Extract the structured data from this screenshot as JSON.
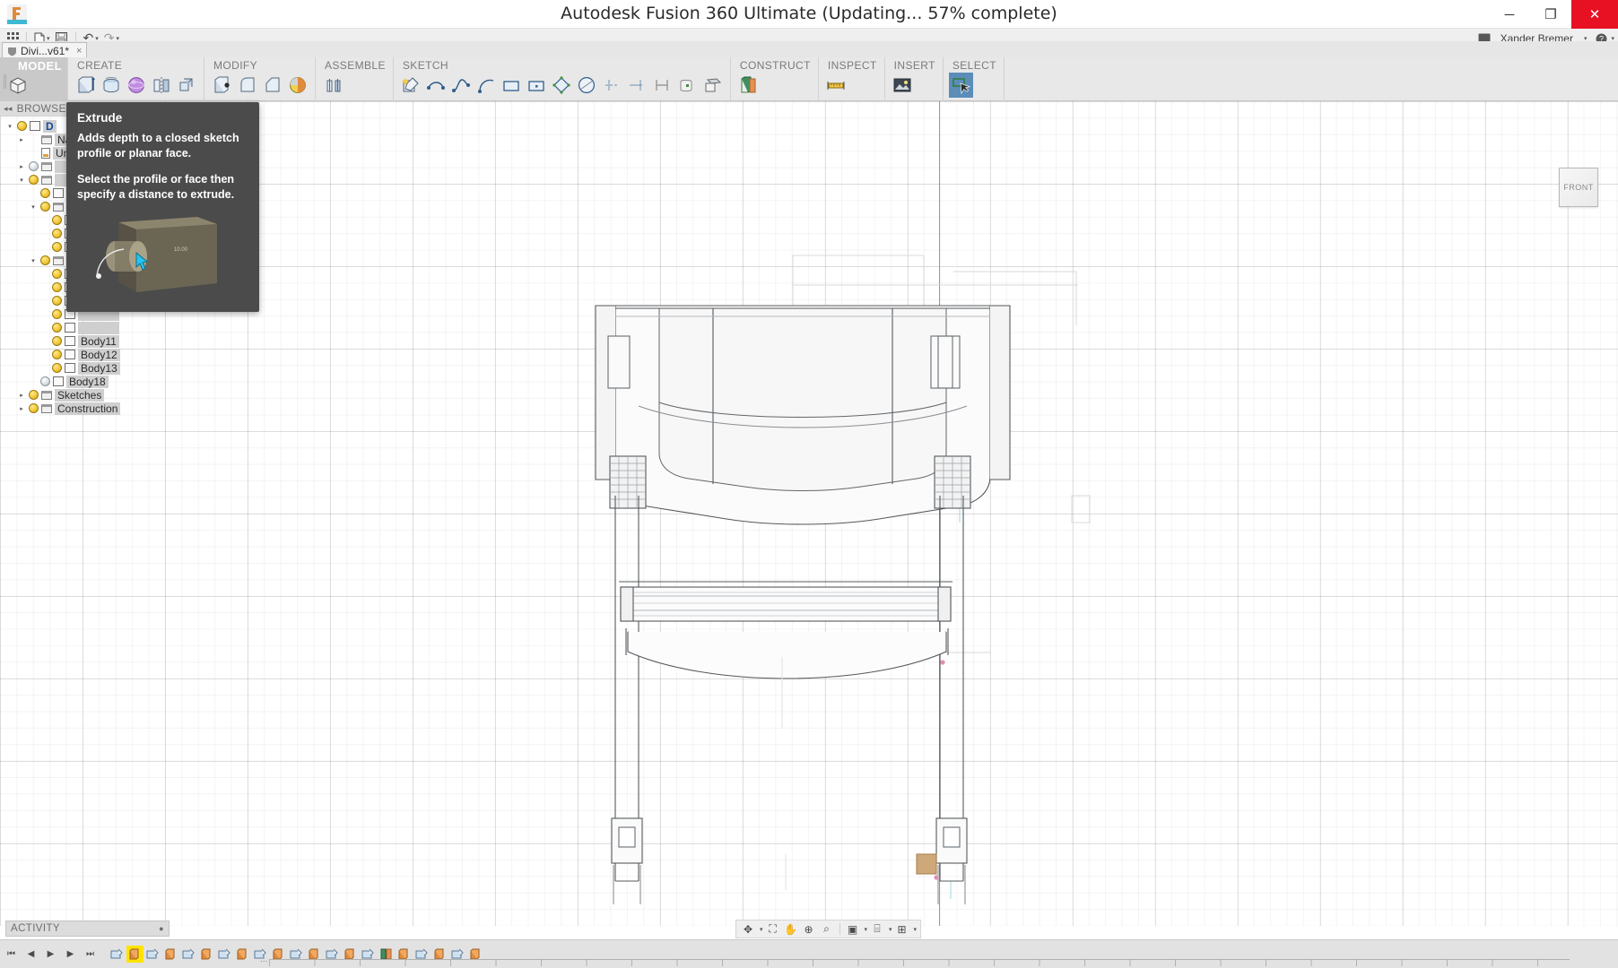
{
  "window": {
    "title": "Autodesk Fusion 360 Ultimate  (Updating... 57% complete)",
    "minimize_label": "─",
    "restore_label": "❐",
    "close_label": "✕",
    "app_icon": "fusion-360-logo"
  },
  "quick_access": {
    "grid_label": "▒",
    "new_label": "⬜",
    "save_label": "💾",
    "undo_label": "↶",
    "redo_label": "↷",
    "caret": "▾",
    "jobs_icon": "job-status-icon",
    "user_name": "Xander Bremer",
    "help_label": "?"
  },
  "document_tab": {
    "label": "Divi...v61*",
    "close_label": "×",
    "icon": "document-shield-icon"
  },
  "ribbon": {
    "groups": [
      {
        "name": "MODEL",
        "label": "MODEL",
        "is_workspace": true,
        "items": [
          {
            "name": "model-workspace-icon",
            "glyph": "box"
          }
        ]
      },
      {
        "name": "CREATE",
        "label": "CREATE",
        "items": [
          {
            "name": "extrude-icon",
            "glyph": "extrude"
          },
          {
            "name": "revolve-icon",
            "glyph": "revolve"
          },
          {
            "name": "sweep-icon",
            "glyph": "sphere"
          },
          {
            "name": "mirror-icon",
            "glyph": "mirror"
          },
          {
            "name": "pattern-icon",
            "glyph": "pattern"
          }
        ]
      },
      {
        "name": "MODIFY",
        "label": "MODIFY",
        "items": [
          {
            "name": "press-pull-icon",
            "glyph": "presspull"
          },
          {
            "name": "fillet-icon",
            "glyph": "fillet"
          },
          {
            "name": "chamfer-icon",
            "glyph": "chamfer"
          },
          {
            "name": "appearance-icon",
            "glyph": "appearance"
          }
        ]
      },
      {
        "name": "ASSEMBLE",
        "label": "ASSEMBLE",
        "items": [
          {
            "name": "joint-icon",
            "glyph": "joint"
          }
        ]
      },
      {
        "name": "SKETCH",
        "label": "SKETCH",
        "items": [
          {
            "name": "create-sketch-icon",
            "glyph": "newsketch"
          },
          {
            "name": "line-icon",
            "glyph": "spline"
          },
          {
            "name": "spline-icon",
            "glyph": "spline2"
          },
          {
            "name": "arc-icon",
            "glyph": "arc"
          },
          {
            "name": "rectangle-icon",
            "glyph": "rect"
          },
          {
            "name": "center-rectangle-icon",
            "glyph": "rectc"
          },
          {
            "name": "polygon-icon",
            "glyph": "diamond"
          },
          {
            "name": "ellipse-icon",
            "glyph": "ellipse"
          },
          {
            "name": "sketch-dimension-icon",
            "glyph": "dim1"
          },
          {
            "name": "trim-icon",
            "glyph": "dim2"
          },
          {
            "name": "offset-icon",
            "glyph": "offset"
          },
          {
            "name": "project-icon",
            "glyph": "project"
          },
          {
            "name": "stop-sketch-icon",
            "glyph": "stopsketch"
          }
        ]
      },
      {
        "name": "CONSTRUCT",
        "label": "CONSTRUCT",
        "items": [
          {
            "name": "construct-plane-icon",
            "glyph": "plane"
          }
        ]
      },
      {
        "name": "INSPECT",
        "label": "INSPECT",
        "items": [
          {
            "name": "measure-icon",
            "glyph": "ruler"
          }
        ]
      },
      {
        "name": "INSERT",
        "label": "INSERT",
        "items": [
          {
            "name": "insert-mcmaster-icon",
            "glyph": "image"
          }
        ]
      },
      {
        "name": "SELECT",
        "label": "SELECT",
        "items": [
          {
            "name": "select-icon",
            "glyph": "select",
            "selected": true
          }
        ]
      }
    ]
  },
  "browser": {
    "header": "BROWSER",
    "collapse_icon": "◂◂",
    "tree": [
      {
        "label": "D",
        "indent": 0,
        "arrow": "open",
        "bulb": "on",
        "icon": "body",
        "root": true
      },
      {
        "label": "Na",
        "indent": 1,
        "arrow": "closed",
        "bulb": "none",
        "icon": "folder"
      },
      {
        "label": "Un",
        "indent": 1,
        "arrow": "none",
        "bulb": "none",
        "icon": "doc"
      },
      {
        "label": "",
        "indent": 1,
        "arrow": "closed",
        "bulb": "off",
        "icon": "folder"
      },
      {
        "label": "",
        "indent": 1,
        "arrow": "open",
        "bulb": "on",
        "icon": "folder"
      },
      {
        "label": "",
        "indent": 2,
        "arrow": "none",
        "bulb": "on",
        "icon": "body"
      },
      {
        "label": "",
        "indent": 2,
        "arrow": "open",
        "bulb": "on",
        "icon": "folder"
      },
      {
        "label": "",
        "indent": 3,
        "arrow": "none",
        "bulb": "on",
        "icon": "body"
      },
      {
        "label": "",
        "indent": 3,
        "arrow": "none",
        "bulb": "on",
        "icon": "body"
      },
      {
        "label": "",
        "indent": 3,
        "arrow": "none",
        "bulb": "on",
        "icon": "body"
      },
      {
        "label": "",
        "indent": 2,
        "arrow": "open",
        "bulb": "on",
        "icon": "folder"
      },
      {
        "label": "",
        "indent": 3,
        "arrow": "none",
        "bulb": "on",
        "icon": "body"
      },
      {
        "label": "",
        "indent": 3,
        "arrow": "none",
        "bulb": "on",
        "icon": "body"
      },
      {
        "label": "",
        "indent": 3,
        "arrow": "none",
        "bulb": "on",
        "icon": "body"
      },
      {
        "label": "",
        "indent": 3,
        "arrow": "none",
        "bulb": "on",
        "icon": "body"
      },
      {
        "label": "",
        "indent": 3,
        "arrow": "none",
        "bulb": "on",
        "icon": "body"
      },
      {
        "label": "Body11",
        "indent": 3,
        "arrow": "none",
        "bulb": "on",
        "icon": "body"
      },
      {
        "label": "Body12",
        "indent": 3,
        "arrow": "none",
        "bulb": "on",
        "icon": "body"
      },
      {
        "label": "Body13",
        "indent": 3,
        "arrow": "none",
        "bulb": "on",
        "icon": "body"
      },
      {
        "label": "Body18",
        "indent": 2,
        "arrow": "none",
        "bulb": "off",
        "icon": "body"
      },
      {
        "label": "Sketches",
        "indent": 1,
        "arrow": "closed",
        "bulb": "on",
        "icon": "folder"
      },
      {
        "label": "Construction",
        "indent": 1,
        "arrow": "closed",
        "bulb": "on",
        "icon": "folder"
      }
    ]
  },
  "tooltip": {
    "title": "Extrude",
    "paragraph1": "Adds depth to a closed sketch profile or planar face.",
    "paragraph2": "Select the profile or face then specify a distance to extrude.",
    "image_name": "extrude-preview-cylinder"
  },
  "viewcube": {
    "face_label": "FRONT"
  },
  "canvas": {
    "model_name": "chair-front-orthographic-view",
    "view_orientation": "FRONT",
    "background_color": "#ffffff",
    "grid_color": "#e8e8e8",
    "axis_color": "#6f86c9"
  },
  "activity_panel": {
    "label": "ACTIVITY",
    "menu_icon": "●"
  },
  "nav_bar": {
    "items": [
      {
        "name": "orbit-icon",
        "glyph": "✥",
        "has_caret": true
      },
      {
        "name": "fit-icon",
        "glyph": "⛶",
        "has_caret": false
      },
      {
        "name": "pan-icon",
        "glyph": "✋",
        "has_caret": false
      },
      {
        "name": "zoom-icon",
        "glyph": "⊕",
        "has_caret": false
      },
      {
        "name": "zoom-window-icon",
        "glyph": "⌕",
        "has_caret": false
      },
      {
        "name": "display-settings-icon",
        "glyph": "▣",
        "has_caret": true
      },
      {
        "name": "grid-snaps-icon",
        "glyph": "⌸",
        "has_caret": true
      },
      {
        "name": "viewports-icon",
        "glyph": "⊞",
        "has_caret": true
      }
    ]
  },
  "timeline": {
    "playback": [
      {
        "name": "timeline-begin-button",
        "glyph": "⏮"
      },
      {
        "name": "timeline-step-back-button",
        "glyph": "◀"
      },
      {
        "name": "timeline-play-back-button",
        "glyph": "▶"
      },
      {
        "name": "timeline-step-forward-button",
        "glyph": "▶"
      },
      {
        "name": "timeline-end-button",
        "glyph": "⏭"
      }
    ],
    "features": [
      {
        "type": "sketch",
        "active": false
      },
      {
        "type": "extrude",
        "active": true
      },
      {
        "type": "sketch",
        "active": false
      },
      {
        "type": "extrude",
        "active": false
      },
      {
        "type": "sketch",
        "active": false
      },
      {
        "type": "extrude",
        "active": false
      },
      {
        "type": "sketch",
        "active": false
      },
      {
        "type": "extrude",
        "active": false
      },
      {
        "type": "sketch",
        "active": false
      },
      {
        "type": "extrude",
        "active": false
      },
      {
        "type": "sketch",
        "active": false
      },
      {
        "type": "extrude",
        "active": false
      },
      {
        "type": "sketch",
        "active": false
      },
      {
        "type": "extrude",
        "active": false
      },
      {
        "type": "sketch",
        "active": false
      },
      {
        "type": "plane",
        "active": false
      },
      {
        "type": "extrude",
        "active": false
      },
      {
        "type": "sketch",
        "active": false
      },
      {
        "type": "extrude",
        "active": false
      },
      {
        "type": "sketch",
        "active": false
      },
      {
        "type": "extrude",
        "active": false
      }
    ],
    "overflow_label": "..."
  }
}
